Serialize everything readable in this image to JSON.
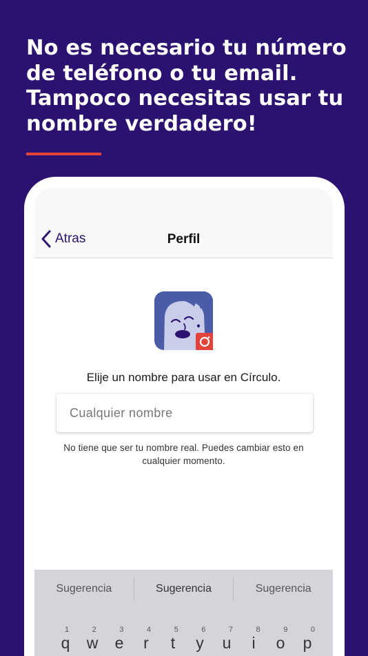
{
  "headline": {
    "lines": [
      "No es necesario tu número",
      "de teléfono o tu email.",
      "Tampoco necesitas usar tu",
      "nombre verdadero!"
    ]
  },
  "colors": {
    "background": "#2b1270",
    "accent": "#e2433a",
    "avatar_bg": "#4a5ca8"
  },
  "navbar": {
    "back_label": "Atras",
    "title": "Perfil"
  },
  "profile": {
    "avatar_icon": "face-avatar-icon",
    "camera_icon": "camera-icon",
    "prompt": "Elije un nombre para usar en Círculo.",
    "name_placeholder": "Cualquier nombre",
    "hint": "No tiene que ser tu nombre real. Puedes cambiar esto en cualquier momento."
  },
  "keyboard": {
    "suggestions": [
      "Sugerencia",
      "Sugerencia",
      "Sugerencia"
    ],
    "numbers": [
      "1",
      "2",
      "3",
      "4",
      "5",
      "6",
      "7",
      "8",
      "9",
      "0"
    ],
    "keys": [
      "q",
      "w",
      "e",
      "r",
      "t",
      "y",
      "u",
      "i",
      "o",
      "p"
    ]
  }
}
